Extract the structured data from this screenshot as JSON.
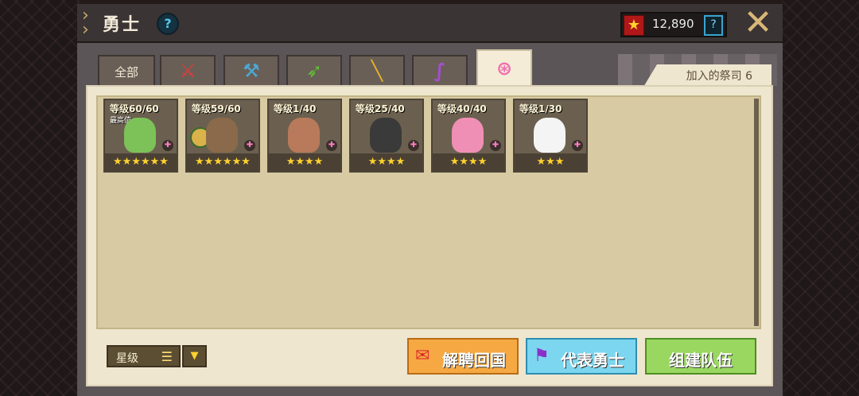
{
  "header": {
    "title": "勇士",
    "help_icon": "question-icon",
    "currency": {
      "icon": "star-medal-icon",
      "value": "12,890",
      "help": "?"
    },
    "close_icon": "close-x-icon"
  },
  "tabs": [
    {
      "label": "全部",
      "icon": ""
    },
    {
      "label": "",
      "icon": "sword-icon",
      "color": "#e23a3a"
    },
    {
      "label": "",
      "icon": "hammer-icon",
      "color": "#4aa9d6"
    },
    {
      "label": "",
      "icon": "bow-icon",
      "color": "#5fc034"
    },
    {
      "label": "",
      "icon": "gun-icon",
      "color": "#e6b428"
    },
    {
      "label": "",
      "icon": "staff-icon",
      "color": "#a24ed0"
    },
    {
      "label": "",
      "icon": "priest-icon",
      "color": "#f06fb0",
      "active": true
    }
  ],
  "join_label": "加入的祭司 6",
  "heroes": [
    {
      "level": "等级60/60",
      "max_tag": "最高值",
      "stars": "★★★★★★",
      "portrait": "#7cc258",
      "class_icon": "priest-icon"
    },
    {
      "level": "等级59/60",
      "max_tag": "",
      "stars": "★★★★★★",
      "portrait": "#8a6a4a",
      "class_icon": "priest-icon"
    },
    {
      "level": "等级1/40",
      "max_tag": "",
      "stars": "★★★★",
      "portrait": "#b87a5a",
      "class_icon": "priest-icon"
    },
    {
      "level": "等级25/40",
      "max_tag": "",
      "stars": "★★★★",
      "portrait": "#3a3a3a",
      "class_icon": "priest-icon"
    },
    {
      "level": "等级40/40",
      "max_tag": "",
      "stars": "★★★★",
      "portrait": "#f08fb5",
      "class_icon": "priest-icon"
    },
    {
      "level": "等级1/30",
      "max_tag": "",
      "stars": "★★★",
      "portrait": "#f4f4f4",
      "class_icon": "priest-icon"
    }
  ],
  "sort": {
    "label": "星级",
    "icon": "list-icon",
    "dropdown_icon": "triangle-down-icon"
  },
  "buttons": {
    "dismiss": "解聘回国",
    "representative": "代表勇士",
    "form_team": "组建队伍"
  }
}
